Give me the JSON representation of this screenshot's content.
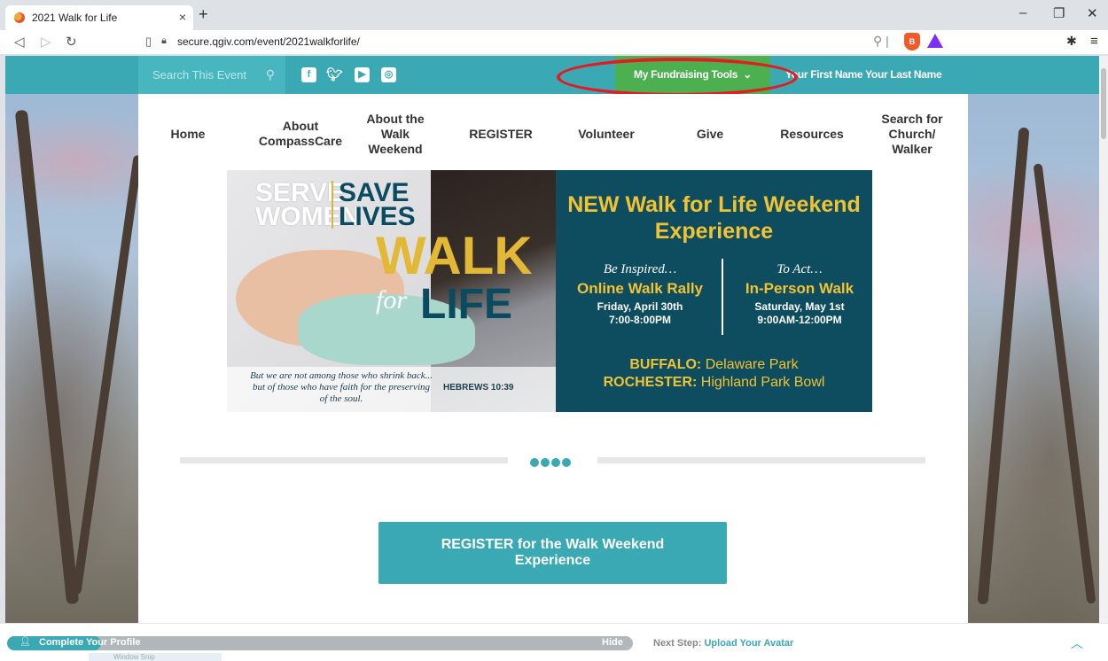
{
  "browser": {
    "tab_title": "2021 Walk for Life",
    "tab_close": "×",
    "new_tab": "+",
    "url": "secure.qgiv.com/event/2021walkforlife/",
    "window_controls": [
      "–",
      "❐",
      "✕"
    ]
  },
  "topbar": {
    "search_placeholder": "Search This Event",
    "social_icons": [
      "facebook-icon",
      "twitter-icon",
      "youtube-icon",
      "instagram-icon"
    ],
    "fundraising_label": "My Fundraising Tools",
    "fundraising_chevron": "⌄",
    "user_name": "Your First Name Your Last Name",
    "colors": {
      "teal": "#3aa9b3",
      "green": "#4caf50",
      "annotation": "#e31b23"
    }
  },
  "nav": {
    "items": [
      "Home",
      "About CompassCare",
      "About the Walk Weekend",
      "REGISTER",
      "Volunteer",
      "Give",
      "Resources",
      "Search for Church/ Walker"
    ]
  },
  "banner": {
    "serve": "SERVE",
    "women": "WOMEN",
    "save": "SAVE",
    "lives": "LIVES",
    "walk": "WALK",
    "for": "for",
    "life": "LIFE",
    "verse": "But we are not among those who shrink back... but of those who have faith for the preserving of the soul.",
    "verse_ref": "HEBREWS 10:39",
    "headline": "NEW Walk for Life Weekend Experience",
    "left_intro": "Be Inspired…",
    "left_title": "Online Walk Rally",
    "left_date": "Friday, April 30th",
    "left_time": "7:00-8:00PM",
    "right_intro": "To Act…",
    "right_title": "In-Person Walk",
    "right_date": "Saturday, May 1st",
    "right_time": "9:00AM-12:00PM",
    "loc1_city": "BUFFALO:",
    "loc1_place": "Delaware Park",
    "loc2_city": "ROCHESTER:",
    "loc2_place": "Highland Park Bowl"
  },
  "carousel": {
    "dot_count": 4
  },
  "register_button": "REGISTER for the Walk Weekend Experience",
  "profile_bar": {
    "label": "Complete Your Profile",
    "hide": "Hide",
    "next_step_label": "Next Step:",
    "next_step_link": "Upload Your Avatar",
    "progress_fraction": 0.15,
    "snip_label": "Window Snip"
  }
}
